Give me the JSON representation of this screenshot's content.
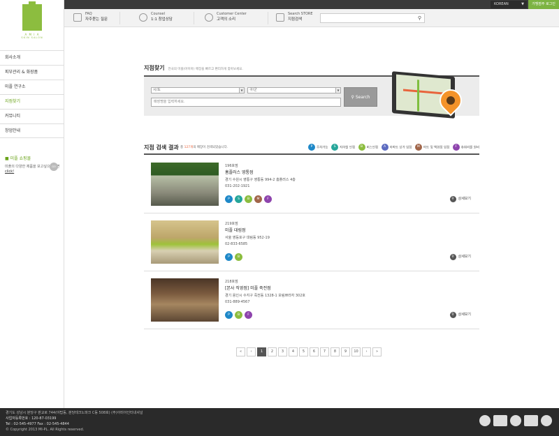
{
  "topbar": {
    "language": "KOREAN",
    "login": "가맹점주 로그인"
  },
  "logo": {
    "brand": "A M I A",
    "sub": "SKIN SALON"
  },
  "sidebar": {
    "items": [
      {
        "label": "회사소개"
      },
      {
        "label": "피부관리 & 화장품"
      },
      {
        "label": "미플 연구소"
      },
      {
        "label": "지점찾기"
      },
      {
        "label": "커뮤니티"
      },
      {
        "label": "창업안내"
      }
    ],
    "shop": {
      "title": "미플 쇼핑몰",
      "desc": "미플의 다양한 제품을 보고싶으시다면",
      "link": "click!",
      "go": "GO"
    }
  },
  "utilbar": {
    "faq_en": "FAQ",
    "faq_ko": "자주묻는 질문",
    "counsel_en": "Counsel",
    "counsel_ko": "1:1 창업상담",
    "center_en": "Customer Center",
    "center_ko": "고객의 소리",
    "store_en": "Search STORE",
    "store_ko": "지점검색"
  },
  "finder": {
    "title": "지점찾기",
    "subtitle": "전국의 미플(아이아) 매장을 빠르고 편리하게 찾아보세요.",
    "city_placeholder": "시/도",
    "district_placeholder": "구/군",
    "name_placeholder": "매장명을 입력하세요.",
    "search_label": "Search"
  },
  "results": {
    "title": "지점 검색 결과",
    "count_prefix": "총 ",
    "count": "127개",
    "count_suffix": "의 매장이 검색되었습니다.",
    "legend": [
      {
        "icon": "P",
        "label": "주차가능",
        "color": "#1e88c8"
      },
      {
        "icon": "S",
        "label": "지하철 인접",
        "color": "#26a69a"
      },
      {
        "icon": "B",
        "label": "버스인접",
        "color": "#8cbd3f"
      },
      {
        "icon": "A",
        "label": "아파트 상가 입점",
        "color": "#5c6bc0"
      },
      {
        "icon": "M",
        "label": "마트 및 백화점 입점",
        "color": "#a1664a"
      },
      {
        "icon": "F",
        "label": "휴휘리를 원비",
        "color": "#8e44ad"
      }
    ],
    "stores": [
      {
        "num": "196호점",
        "name": "홈플러스 영통점",
        "address": "경기 수원시 영통구 영통동 994-2 홈플러스 4층",
        "tel": "031-202-1921",
        "icons": [
          "P",
          "S",
          "B",
          "M",
          "F"
        ],
        "detail": "상세보기"
      },
      {
        "num": "219호점",
        "name": "미플 대림점",
        "address": "서울 영등포구 대림동 952-19",
        "tel": "02-833-6585",
        "icons": [
          "P",
          "B"
        ],
        "detail": "상세보기"
      },
      {
        "num": "218호점",
        "name": "[본사 직영점] 미플 죽전점",
        "address": "경기 용인시 수지구 죽전동 1328-1 보림쁘라자 302호",
        "tel": "031-889-4567",
        "icons": [
          "P",
          "B",
          "F"
        ],
        "detail": "상세보기"
      }
    ]
  },
  "pager": {
    "first": "«",
    "prev": "‹",
    "pages": [
      "1",
      "2",
      "3",
      "4",
      "5",
      "6",
      "7",
      "8",
      "9",
      "10"
    ],
    "next": "›",
    "last": "»"
  },
  "footer": {
    "line1": "경기도 성남시 분당구 판교로 744(야탑동, 분당테크노파크 C동 508호) (주)아미아인터내셔널",
    "line2": "사업자등록번호 : 120-87-03199",
    "line3": "Tel : 02-545-4977 Fax : 02-545-4844",
    "line4": "© Copyright 2013 MI-PL. All Rights reserved."
  }
}
